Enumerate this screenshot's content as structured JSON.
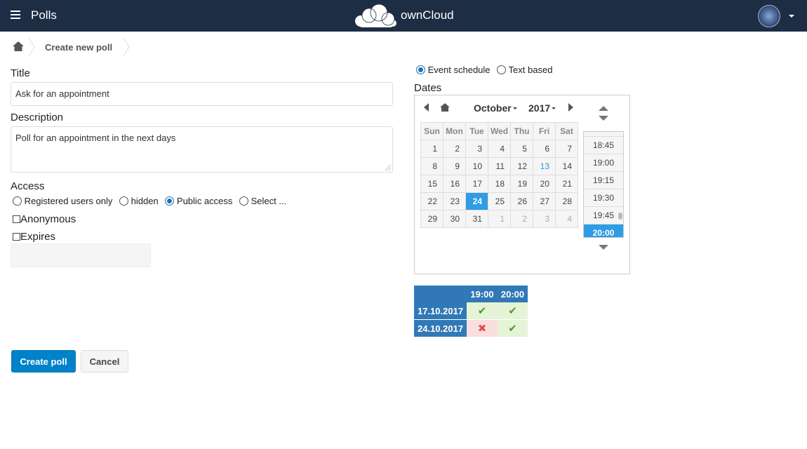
{
  "header": {
    "app_name": "Polls",
    "brand": "ownCloud"
  },
  "breadcrumb": {
    "current": "Create new poll"
  },
  "form": {
    "title_label": "Title",
    "title_value": "Ask for an appointment",
    "description_label": "Description",
    "description_value": "Poll for an appointment in the next days",
    "access_label": "Access",
    "access_options": [
      "Registered users only",
      "hidden",
      "Public access",
      "Select ..."
    ],
    "access_selected": "Public access",
    "anonymous_label": "Anonymous",
    "expires_label": "Expires"
  },
  "poll_type": {
    "options": [
      "Event schedule",
      "Text based"
    ],
    "selected": "Event schedule"
  },
  "dates": {
    "label": "Dates",
    "month": "October",
    "year": "2017",
    "weekdays": [
      "Sun",
      "Mon",
      "Tue",
      "Wed",
      "Thu",
      "Fri",
      "Sat"
    ],
    "weeks": [
      [
        "1",
        "2",
        "3",
        "4",
        "5",
        "6",
        "7"
      ],
      [
        "8",
        "9",
        "10",
        "11",
        "12",
        "13",
        "14"
      ],
      [
        "15",
        "16",
        "17",
        "18",
        "19",
        "20",
        "21"
      ],
      [
        "22",
        "23",
        "24",
        "25",
        "26",
        "27",
        "28"
      ],
      [
        "29",
        "30",
        "31",
        "1",
        "2",
        "3",
        "4"
      ]
    ],
    "selected_day": "24",
    "today": "13",
    "times": [
      "18:45",
      "19:00",
      "19:15",
      "19:30",
      "19:45",
      "20:00"
    ],
    "selected_time": "20:00"
  },
  "summary": {
    "times": [
      "19:00",
      "20:00"
    ],
    "rows": [
      {
        "date": "17.10.2017",
        "votes": [
          "yes",
          "yes"
        ]
      },
      {
        "date": "24.10.2017",
        "votes": [
          "no",
          "yes"
        ]
      }
    ]
  },
  "buttons": {
    "create": "Create poll",
    "cancel": "Cancel"
  },
  "colors": {
    "header_bg": "#1d2d44",
    "primary": "#0082c9",
    "calendar_selected": "#2f9ce6",
    "summary_header": "#3179b6"
  }
}
